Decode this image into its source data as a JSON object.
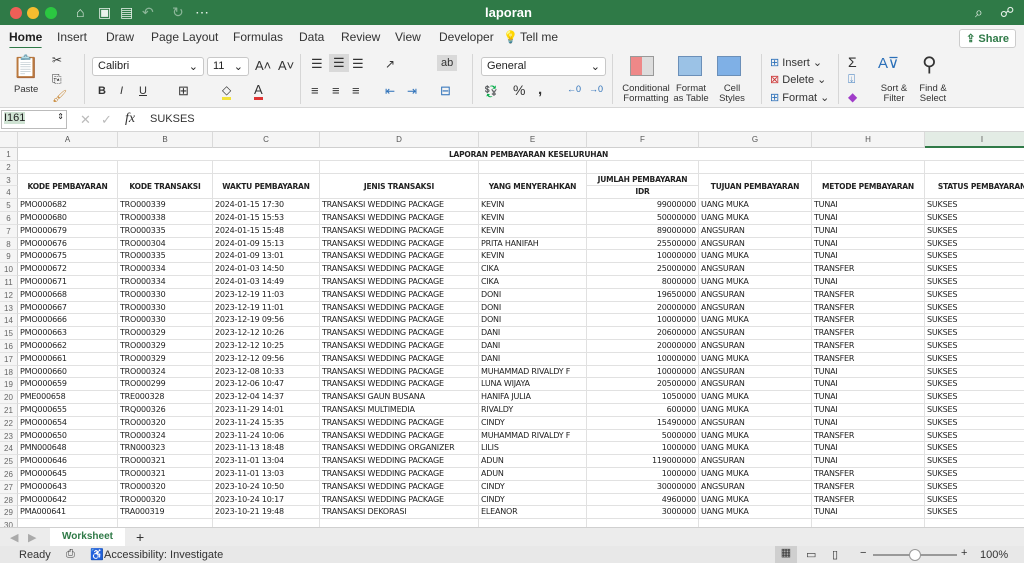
{
  "window": {
    "title": "laporan"
  },
  "menu_tabs": [
    "Home",
    "Insert",
    "Draw",
    "Page Layout",
    "Formulas",
    "Data",
    "Review",
    "View",
    "Developer"
  ],
  "tell_me": "Tell me",
  "share": "Share",
  "ribbon": {
    "paste": "Paste",
    "font": "Calibri",
    "font_size": "11",
    "number_format": "General",
    "conditional_formatting": "Conditional Formatting",
    "format_as_table": "Format as Table",
    "cell_styles": "Cell Styles",
    "insert": "Insert",
    "delete": "Delete",
    "format": "Format",
    "sort_filter": "Sort & Filter",
    "find_select": "Find & Select"
  },
  "formula_bar": {
    "cell_ref": "I161",
    "fx": "fx",
    "value": "SUKSES"
  },
  "columns": [
    "A",
    "B",
    "C",
    "D",
    "E",
    "F",
    "G",
    "H",
    "I"
  ],
  "sheet": {
    "title": "LAPORAN PEMBAYARAN KESELURUHAN",
    "headers": [
      "KODE PEMBAYARAN",
      "KODE TRANSAKSI",
      "WAKTU PEMBAYARAN",
      "JENIS TRANSAKSI",
      "YANG MENYERAHKAN",
      "JUMLAH PEMBAYARAN",
      "TUJUAN PEMBAYARAN",
      "METODE PEMBAYARAN",
      "STATUS PEMBAYARAN"
    ],
    "subheader_currency": "IDR",
    "rows": [
      [
        "PMO000682",
        "TRO000339",
        "2024-01-15 17:30",
        "TRANSAKSI WEDDING PACKAGE",
        "KEVIN",
        "99000000",
        "UANG MUKA",
        "TUNAI",
        "SUKSES"
      ],
      [
        "PMO000680",
        "TRO000338",
        "2024-01-15 15:53",
        "TRANSAKSI WEDDING PACKAGE",
        "KEVIN",
        "50000000",
        "UANG MUKA",
        "TUNAI",
        "SUKSES"
      ],
      [
        "PMO000679",
        "TRO000335",
        "2024-01-15 15:48",
        "TRANSAKSI WEDDING PACKAGE",
        "KEVIN",
        "89000000",
        "ANGSURAN",
        "TUNAI",
        "SUKSES"
      ],
      [
        "PMO000676",
        "TRO000304",
        "2024-01-09 15:13",
        "TRANSAKSI WEDDING PACKAGE",
        "PRITA HANIFAH",
        "25500000",
        "ANGSURAN",
        "TUNAI",
        "SUKSES"
      ],
      [
        "PMO000675",
        "TRO000335",
        "2024-01-09 13:01",
        "TRANSAKSI WEDDING PACKAGE",
        "KEVIN",
        "10000000",
        "UANG MUKA",
        "TUNAI",
        "SUKSES"
      ],
      [
        "PMO000672",
        "TRO000334",
        "2024-01-03 14:50",
        "TRANSAKSI WEDDING PACKAGE",
        "CIKA",
        "25000000",
        "ANGSURAN",
        "TRANSFER",
        "SUKSES"
      ],
      [
        "PMO000671",
        "TRO000334",
        "2024-01-03 14:49",
        "TRANSAKSI WEDDING PACKAGE",
        "CIKA",
        "8000000",
        "UANG MUKA",
        "TUNAI",
        "SUKSES"
      ],
      [
        "PMO000668",
        "TRO000330",
        "2023-12-19 11:03",
        "TRANSAKSI WEDDING PACKAGE",
        "DONI",
        "19650000",
        "ANGSURAN",
        "TRANSFER",
        "SUKSES"
      ],
      [
        "PMO000667",
        "TRO000330",
        "2023-12-19 11:01",
        "TRANSAKSI WEDDING PACKAGE",
        "DONI",
        "20000000",
        "ANGSURAN",
        "TRANSFER",
        "SUKSES"
      ],
      [
        "PMO000666",
        "TRO000330",
        "2023-12-19 09:56",
        "TRANSAKSI WEDDING PACKAGE",
        "DONI",
        "10000000",
        "UANG MUKA",
        "TRANSFER",
        "SUKSES"
      ],
      [
        "PMO000663",
        "TRO000329",
        "2023-12-12 10:26",
        "TRANSAKSI WEDDING PACKAGE",
        "DANI",
        "20600000",
        "ANGSURAN",
        "TRANSFER",
        "SUKSES"
      ],
      [
        "PMO000662",
        "TRO000329",
        "2023-12-12 10:25",
        "TRANSAKSI WEDDING PACKAGE",
        "DANI",
        "20000000",
        "ANGSURAN",
        "TRANSFER",
        "SUKSES"
      ],
      [
        "PMO000661",
        "TRO000329",
        "2023-12-12 09:56",
        "TRANSAKSI WEDDING PACKAGE",
        "DANI",
        "10000000",
        "UANG MUKA",
        "TRANSFER",
        "SUKSES"
      ],
      [
        "PMO000660",
        "TRO000324",
        "2023-12-08 10:33",
        "TRANSAKSI WEDDING PACKAGE",
        "MUHAMMAD RIVALDY F",
        "10000000",
        "ANGSURAN",
        "TUNAI",
        "SUKSES"
      ],
      [
        "PMO000659",
        "TRO000299",
        "2023-12-06 10:47",
        "TRANSAKSI WEDDING PACKAGE",
        "LUNA WIJAYA",
        "20500000",
        "ANGSURAN",
        "TUNAI",
        "SUKSES"
      ],
      [
        "PME000658",
        "TRE000328",
        "2023-12-04 14:37",
        "TRANSAKSI GAUN BUSANA",
        "HANIFA JULIA",
        "1050000",
        "UANG MUKA",
        "TUNAI",
        "SUKSES"
      ],
      [
        "PMQ000655",
        "TRQ000326",
        "2023-11-29 14:01",
        "TRANSAKSI MULTIMEDIA",
        "RIVALDY",
        "600000",
        "UANG MUKA",
        "TUNAI",
        "SUKSES"
      ],
      [
        "PMO000654",
        "TRO000320",
        "2023-11-24 15:35",
        "TRANSAKSI WEDDING PACKAGE",
        "CINDY",
        "15490000",
        "ANGSURAN",
        "TUNAI",
        "SUKSES"
      ],
      [
        "PMO000650",
        "TRO000324",
        "2023-11-24 10:06",
        "TRANSAKSI WEDDING PACKAGE",
        "MUHAMMAD RIVALDY F",
        "5000000",
        "UANG MUKA",
        "TRANSFER",
        "SUKSES"
      ],
      [
        "PMN000648",
        "TRN000323",
        "2023-11-13 18:48",
        "TRANSAKSI WEDDING ORGANIZER",
        "LILIS",
        "1000000",
        "UANG MUKA",
        "TUNAI",
        "SUKSES"
      ],
      [
        "PMO000646",
        "TRO000321",
        "2023-11-01 13:04",
        "TRANSAKSI WEDDING PACKAGE",
        "ADUN",
        "119000000",
        "ANGSURAN",
        "TUNAI",
        "SUKSES"
      ],
      [
        "PMO000645",
        "TRO000321",
        "2023-11-01 13:03",
        "TRANSAKSI WEDDING PACKAGE",
        "ADUN",
        "1000000",
        "UANG MUKA",
        "TRANSFER",
        "SUKSES"
      ],
      [
        "PMO000643",
        "TRO000320",
        "2023-10-24 10:50",
        "TRANSAKSI WEDDING PACKAGE",
        "CINDY",
        "30000000",
        "ANGSURAN",
        "TRANSFER",
        "SUKSES"
      ],
      [
        "PMO000642",
        "TRO000320",
        "2023-10-24 10:17",
        "TRANSAKSI WEDDING PACKAGE",
        "CINDY",
        "4960000",
        "UANG MUKA",
        "TRANSFER",
        "SUKSES"
      ],
      [
        "PMA000641",
        "TRA000319",
        "2023-10-21 19:48",
        "TRANSAKSI DEKORASI",
        "ELEANOR",
        "3000000",
        "UANG MUKA",
        "TUNAI",
        "SUKSES"
      ]
    ]
  },
  "sheet_tab": "Worksheet",
  "status": {
    "ready": "Ready",
    "accessibility": "Accessibility: Investigate",
    "zoom": "100%",
    "zoom_level": 1.0
  },
  "colors": {
    "titlebar": "#2f7a47",
    "accent": "#2f7a47"
  }
}
